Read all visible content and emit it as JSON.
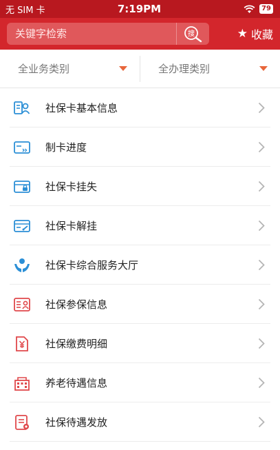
{
  "status_bar": {
    "carrier": "无 SIM 卡",
    "time": "7:19PM",
    "battery": "79"
  },
  "header": {
    "search_placeholder": "关键字检索",
    "search_button_label": "搜",
    "favorite_label": "收藏"
  },
  "filters": [
    {
      "label": "全业务类别"
    },
    {
      "label": "全办理类别"
    }
  ],
  "colors": {
    "brand_red": "#d3262c",
    "status_red": "#b8181f",
    "accent_orange": "#e8663b",
    "icon_blue": "#2b8fd6",
    "icon_red": "#e0484b"
  },
  "items": [
    {
      "label": "社保卡基本信息",
      "icon": "id-card-person-icon"
    },
    {
      "label": "制卡进度",
      "icon": "card-progress-icon"
    },
    {
      "label": "社保卡挂失",
      "icon": "card-lock-icon"
    },
    {
      "label": "社保卡解挂",
      "icon": "card-unlock-icon"
    },
    {
      "label": "社保卡综合服务大厅",
      "icon": "hands-service-icon"
    },
    {
      "label": "社保参保信息",
      "icon": "insurance-card-icon"
    },
    {
      "label": "社保缴费明细",
      "icon": "payment-detail-icon"
    },
    {
      "label": "养老待遇信息",
      "icon": "pension-building-icon"
    },
    {
      "label": "社保待遇发放",
      "icon": "benefit-document-icon"
    }
  ]
}
